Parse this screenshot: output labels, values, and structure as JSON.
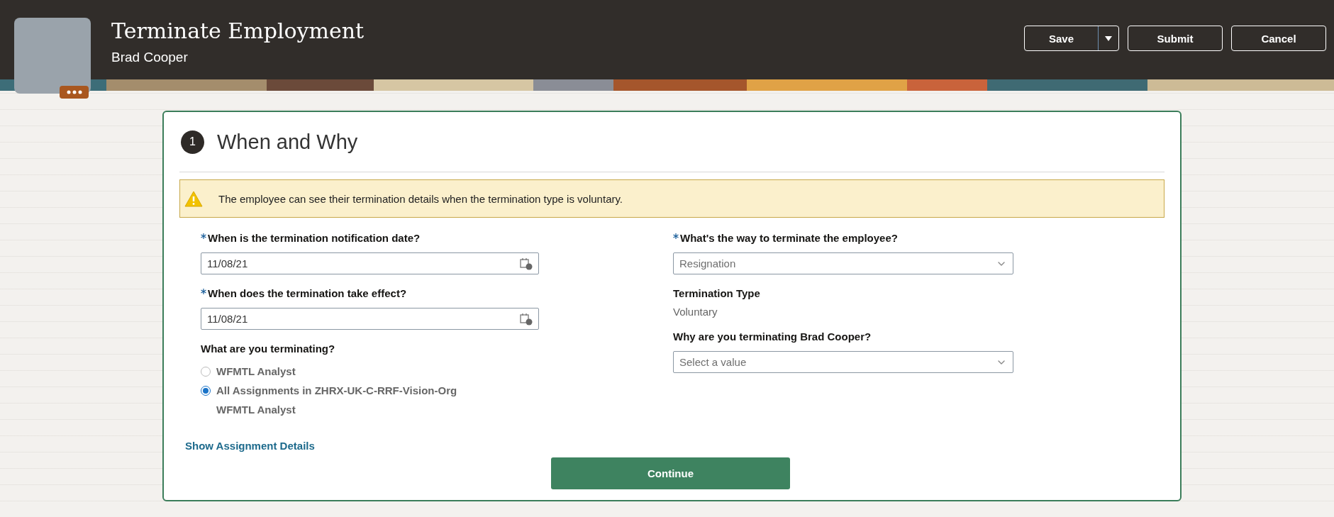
{
  "header": {
    "title": "Terminate Employment",
    "subtitle": "Brad Cooper",
    "buttons": [
      {
        "label": "Save",
        "kind": "split"
      },
      {
        "label": "Submit",
        "kind": "plain"
      },
      {
        "label": "Cancel",
        "kind": "plain"
      }
    ]
  },
  "step": {
    "number": "1",
    "title": "When and Why"
  },
  "warning": {
    "message": "The employee can see their termination details when the termination type is voluntary."
  },
  "left_fields": [
    {
      "kind": "date",
      "label": "When is the termination notification date?",
      "required": true,
      "value": "11/08/21"
    },
    {
      "kind": "date",
      "label": "When does the termination take effect?",
      "required": true,
      "value": "11/08/21"
    }
  ],
  "assignment": {
    "label": "What are you terminating?",
    "options": [
      {
        "label": "WFMTL Analyst",
        "selected": false
      },
      {
        "label": "All Assignments in ZHRX-UK-C-RRF-Vision-Org",
        "selected": true,
        "detail": "WFMTL Analyst"
      }
    ]
  },
  "right_fields": [
    {
      "kind": "select",
      "label": "What's the way to terminate the employee?",
      "required": true,
      "value": "Resignation"
    },
    {
      "kind": "readonly",
      "label": "Termination Type",
      "required": false,
      "value": "Voluntary"
    },
    {
      "kind": "select",
      "label": "Why are you terminating Brad Cooper?",
      "required": false,
      "placeholder": "Select a value"
    }
  ],
  "link": "Show Assignment Details",
  "primary_button": "Continue"
}
